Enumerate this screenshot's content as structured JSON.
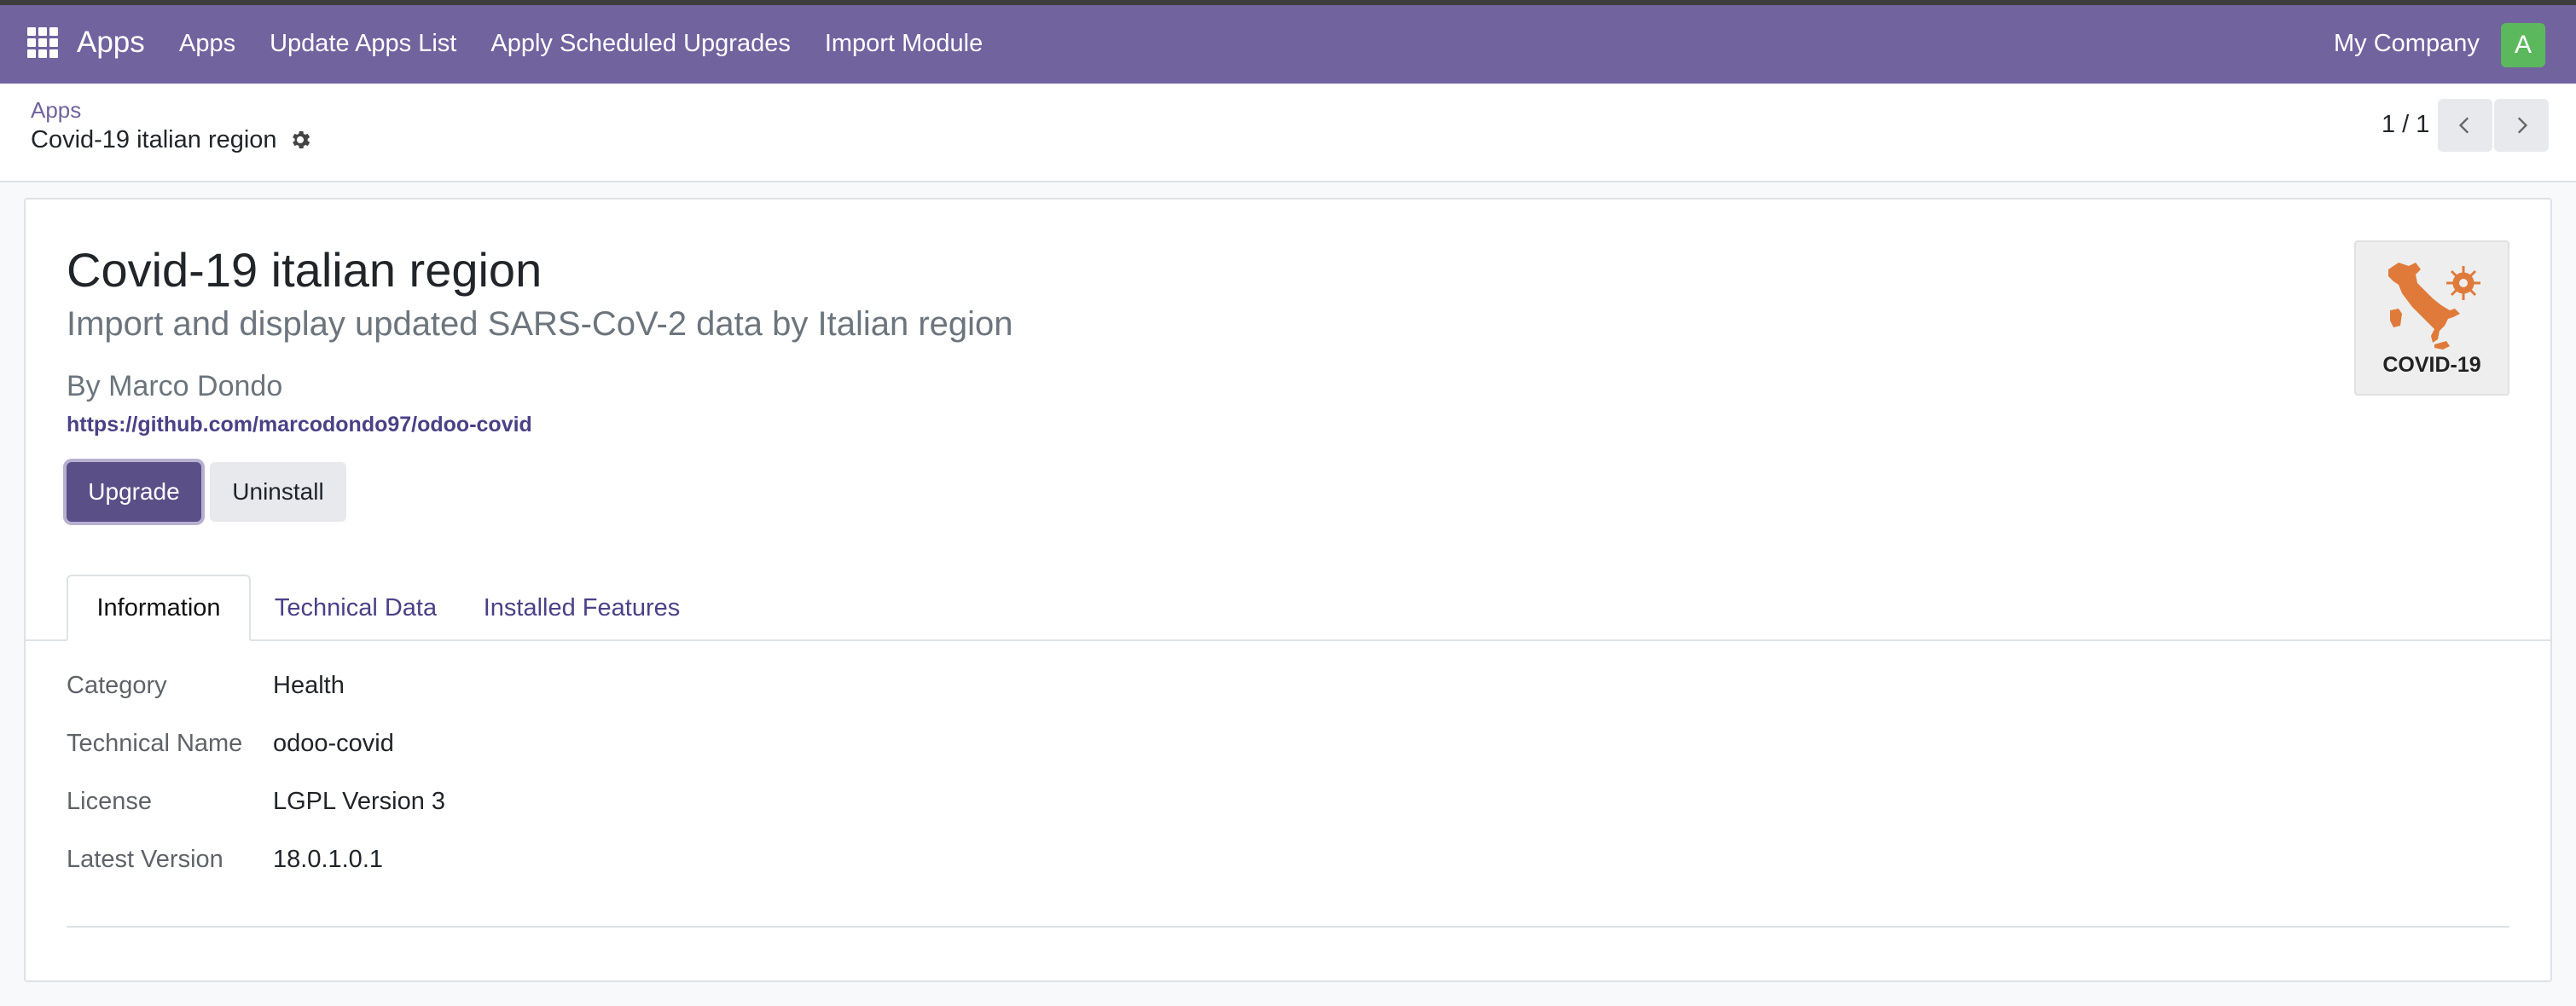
{
  "navbar": {
    "brand": "Apps",
    "menu": [
      "Apps",
      "Update Apps List",
      "Apply Scheduled Upgrades",
      "Import Module"
    ],
    "company": "My Company",
    "avatar_initial": "A",
    "color": "#71639e",
    "avatar_color": "#5cb85c"
  },
  "breadcrumb": {
    "parent": "Apps",
    "current": "Covid-19 italian region"
  },
  "pager": {
    "value": "1 / 1"
  },
  "module": {
    "title": "Covid-19 italian region",
    "summary": "Import and display updated SARS-CoV-2 data by Italian region",
    "author": "By Marco Dondo",
    "website": "https://github.com/marcodondo97/odoo-covid",
    "icon_label": "COVID-19",
    "icon_color": "#e07a3a"
  },
  "buttons": {
    "upgrade": "Upgrade",
    "uninstall": "Uninstall"
  },
  "tabs": [
    "Information",
    "Technical Data",
    "Installed Features"
  ],
  "fields": [
    {
      "label": "Category",
      "value": "Health"
    },
    {
      "label": "Technical Name",
      "value": "odoo-covid"
    },
    {
      "label": "License",
      "value": "LGPL Version 3"
    },
    {
      "label": "Latest Version",
      "value": "18.0.1.0.1"
    }
  ]
}
